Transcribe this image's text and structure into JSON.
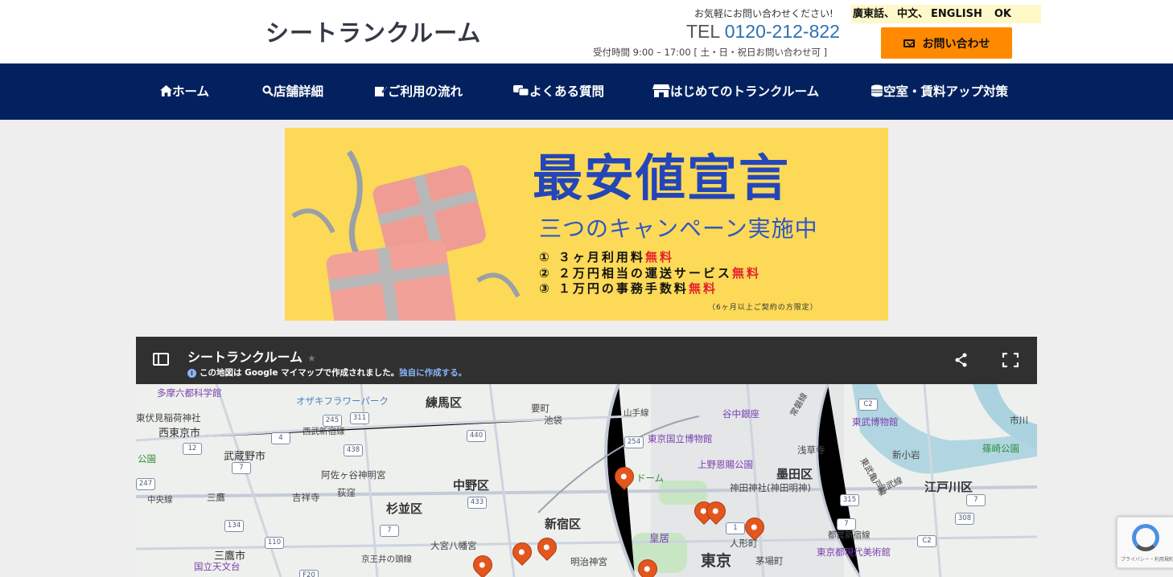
{
  "header": {
    "logo": "シートランクルーム",
    "contact_note": "お気軽にお問い合わせください!",
    "tel_prefix": "TEL",
    "tel_number": "0120-212-822",
    "hours": "受付時間 9:00 – 17:00 [ 土・日・祝日お問い合わせ可 ]",
    "languages": [
      "廣東話、",
      "中文、",
      "ENGLISH"
    ],
    "lang_ok": "OK",
    "contact_button": "お問い合わせ"
  },
  "nav": {
    "items": [
      {
        "icon": "home-icon",
        "label": "ホーム"
      },
      {
        "icon": "search-icon",
        "label": "店舗詳細"
      },
      {
        "icon": "edit-icon",
        "label": "ご利用の流れ"
      },
      {
        "icon": "comments-icon",
        "label": "よくある質問"
      },
      {
        "icon": "store-icon",
        "label": "はじめてのトランクルーム"
      },
      {
        "icon": "coins-icon",
        "label": "空室・賃料アップ対策"
      }
    ]
  },
  "banner": {
    "title": "最安値宣言",
    "subtitle": "三つのキャンペーン実施中",
    "items": [
      {
        "text": "① ３ヶ月利用料",
        "free": "無料"
      },
      {
        "text": "② ２万円相当の運送サービス",
        "free": "無料"
      },
      {
        "text": "③ １万円の事務手数料",
        "free": "無料"
      }
    ],
    "note": "（6ヶ月以上ご契約の方限定）"
  },
  "map": {
    "title": "シートランクルーム",
    "info": "この地図は Google マイマップで作成されました。",
    "info_link": "独自に作成する。",
    "labels": {
      "tama": "多摩六都科学館",
      "higashifushimi": "東伏見稲荷神社",
      "nishitokyo": "西東京市",
      "musashino": "武蔵野市",
      "park": "公園",
      "chuo_line": "中央線",
      "mitaka": "三鷹",
      "kichijoji": "吉祥寺",
      "mitakashi": "三鷹市",
      "tenmondai": "国立天文台",
      "ozeki": "オザキフラワーパーク",
      "seibu": "西武新宿線",
      "asagaya": "阿佐ヶ谷神明宮",
      "ogikubo": "荻窪",
      "suginami": "杉並区",
      "nerima": "練馬区",
      "nakano": "中野区",
      "omiya": "大宮八幡宮",
      "keio": "京王井の頭線",
      "kanamecho": "要町",
      "ikebukuro": "池袋",
      "yamanote": "山手線",
      "shinjuku": "新宿区",
      "meiji": "明治神宮",
      "kokusai": "東京国立博物館",
      "ueno": "上野恩賜公園",
      "yanaka": "谷中銀座",
      "kanda": "神田神社(神田明神)",
      "dome": "ドーム",
      "kokyo": "皇居",
      "tokyo": "東京",
      "ningyocho": "人形町",
      "kayabacho": "茅場町",
      "asakusa": "浅草寺",
      "sumida": "墨田区",
      "tobu_museum": "東武博物館",
      "tobu_line": "東武亀戸線",
      "sobu": "総武線",
      "edogawa": "江戸川区",
      "shinkoiwa": "新小岩",
      "shinozaki": "篠崎公園",
      "ichikawa": "市川",
      "toei": "都営新宿線",
      "mot": "東京都現代美術館",
      "joban": "常磐線"
    },
    "shields": [
      "245",
      "311",
      "440",
      "4",
      "438",
      "12",
      "7",
      "247",
      "134",
      "110",
      "433",
      "7",
      "254",
      "1",
      "315",
      "7",
      "308",
      "C2",
      "C2",
      "7",
      "F20"
    ]
  },
  "recaptcha": {
    "text": "プライバシー・利用規約"
  }
}
